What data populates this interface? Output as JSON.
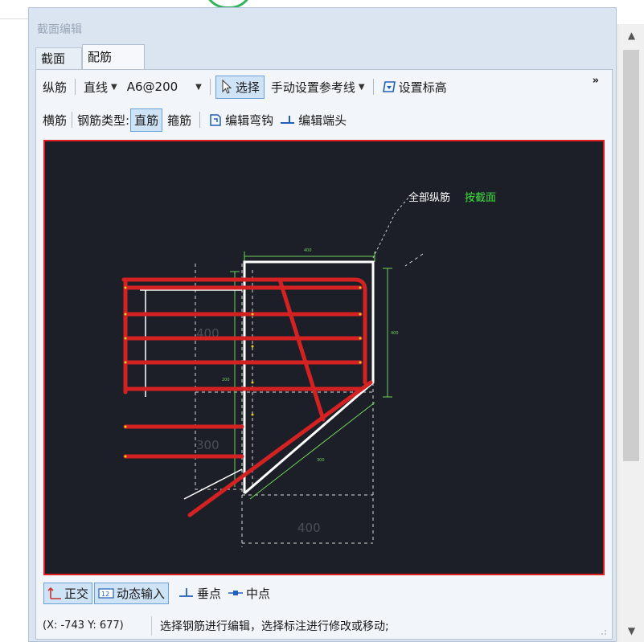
{
  "window": {
    "title": "截面编辑"
  },
  "tabs": [
    {
      "label": "截面"
    },
    {
      "label": "配筋"
    }
  ],
  "toolbar1": {
    "longitudinal": "纵筋",
    "shape": "直线",
    "spec": "A6@200",
    "select": "选择",
    "ref_line": "手动设置参考线",
    "set_elevation": "设置标高",
    "more": "»"
  },
  "toolbar2": {
    "transverse": "横筋",
    "rebar_type_label": "钢筋类型:",
    "straight": "直筋",
    "stirrup": "箍筋",
    "edit_hook": "编辑弯钩",
    "edit_end": "编辑端头"
  },
  "canvas": {
    "annotation_white": "全部纵筋",
    "annotation_green": "按截面",
    "dim_400_top": "400",
    "dim_400_left": "400",
    "dim_300_left": "300",
    "dim_400_bottom": "400",
    "dim_small_top": "400",
    "dim_small_right": "400",
    "dim_small_mid": "200",
    "dim_small_diag": "300",
    "colors": {
      "background": "#1c1f28",
      "rebar": "#d42222",
      "outline": "#ffffff",
      "dimension": "#6fd15a",
      "border": "#e02020"
    }
  },
  "bottom_toolbar": {
    "ortho": "正交",
    "dynamic_input": "动态输入",
    "perpendicular": "垂点",
    "midpoint": "中点"
  },
  "status": {
    "coords": "(X: -743 Y: 677)",
    "message": "选择钢筋进行编辑，选择标注进行修改或移动;"
  }
}
